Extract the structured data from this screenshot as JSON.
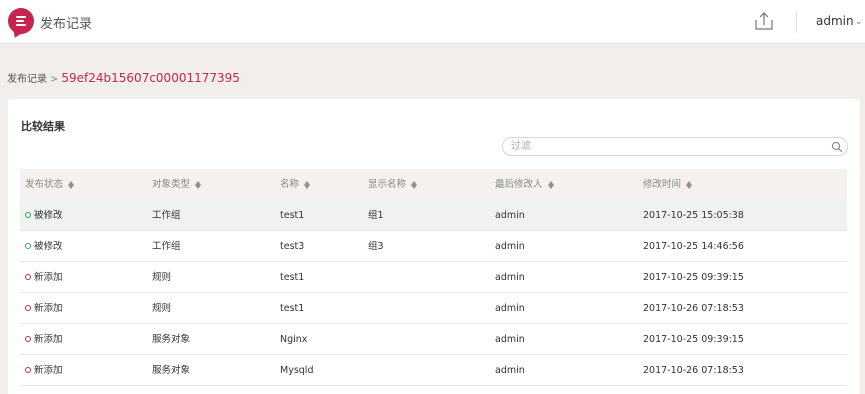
{
  "header": {
    "app_title": "发布记录",
    "user": "admin"
  },
  "breadcrumb": {
    "parent": "发布记录",
    "separator": ">",
    "current": "59ef24b15607c00001177395"
  },
  "panel": {
    "title": "比较结果",
    "filter_placeholder": "过滤"
  },
  "table": {
    "columns": [
      "发布状态",
      "对象类型",
      "名称",
      "显示名称",
      "最后修改人",
      "修改时间"
    ],
    "rows": [
      {
        "status": "被修改",
        "status_color": "#2ea44f",
        "type": "工作组",
        "name": "test1",
        "display_name": "组1",
        "modifier": "admin",
        "time": "2017-10-25 15:05:38"
      },
      {
        "status": "被修改",
        "status_color": "#2ea44f",
        "type": "工作组",
        "name": "test3",
        "display_name": "组3",
        "modifier": "admin",
        "time": "2017-10-25 14:46:56"
      },
      {
        "status": "新添加",
        "status_color": "#c7254e",
        "type": "规则",
        "name": "test1",
        "display_name": "",
        "modifier": "admin",
        "time": "2017-10-25 09:39:15"
      },
      {
        "status": "新添加",
        "status_color": "#c7254e",
        "type": "规则",
        "name": "test1",
        "display_name": "",
        "modifier": "admin",
        "time": "2017-10-26 07:18:53"
      },
      {
        "status": "新添加",
        "status_color": "#c7254e",
        "type": "服务对象",
        "name": "Nginx",
        "display_name": "",
        "modifier": "admin",
        "time": "2017-10-25 09:39:15"
      },
      {
        "status": "新添加",
        "status_color": "#c7254e",
        "type": "服务对象",
        "name": "Mysqld",
        "display_name": "",
        "modifier": "admin",
        "time": "2017-10-26 07:18:53"
      }
    ]
  },
  "icons": {
    "logo": "menu-bubble-icon",
    "upload": "upload-icon",
    "search": "search-icon",
    "sort": "sort-diamond-icon",
    "caret": "chevron-down-icon"
  },
  "colors": {
    "brand": "#c7254e",
    "modified": "#2ea44f",
    "added": "#c7254e"
  }
}
